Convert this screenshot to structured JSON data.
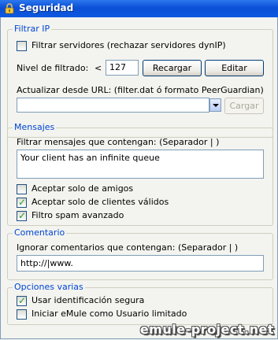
{
  "window": {
    "title": "Seguridad"
  },
  "ipfilter": {
    "legend": "Filtrar IP",
    "filter_servers_label": "Filtrar servidores (rechazar servidores dynIP)",
    "filter_servers_checked": false,
    "level_label": "Nivel de filtrado:",
    "level_op": "<",
    "level_value": "127",
    "reload_label": "Recargar",
    "edit_label": "Editar",
    "update_label": "Actualizar desde URL: (filter.dat ó formato PeerGuardian)",
    "url_value": "",
    "load_label": "Cargar"
  },
  "messages": {
    "legend": "Mensajes",
    "filter_label": "Filtrar mensajes que contengan: (Separador | )",
    "filter_value": "Your client has an infinite queue",
    "friends_only_label": "Aceptar solo de amigos",
    "friends_only_checked": false,
    "valid_clients_label": "Aceptar solo de clientes válidos",
    "valid_clients_checked": true,
    "spam_filter_label": "Filtro spam avanzado",
    "spam_filter_checked": true
  },
  "comments": {
    "legend": "Comentario",
    "ignore_label": "Ignorar comentarios que contengan: (Separador | )",
    "ignore_value": "http://|www."
  },
  "misc": {
    "legend": "Opciones varias",
    "secure_id_label": "Usar identificación segura",
    "secure_id_checked": true,
    "limited_user_label": "Iniciar eMule como Usuario limitado",
    "limited_user_checked": false
  },
  "watermark": "emule-project.net"
}
